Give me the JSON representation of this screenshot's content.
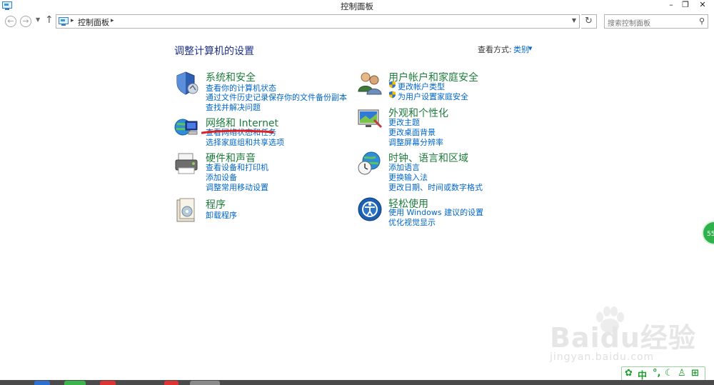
{
  "window": {
    "title": "控制面板",
    "minimize_glyph": "–",
    "restore_glyph": "❐",
    "close_glyph": "✕"
  },
  "address_bar": {
    "path": "控制面板",
    "search_placeholder": "搜索控制面板"
  },
  "main": {
    "heading": "调整计算机的设置",
    "view_by_label": "查看方式:",
    "view_by_value": "类别"
  },
  "categories_left": [
    {
      "title": "系统和安全",
      "icon": "shield-icon",
      "links": [
        "查看你的计算机状态",
        "通过文件历史记录保存你的文件备份副本",
        "查找并解决问题"
      ]
    },
    {
      "title": "网络和 Internet",
      "icon": "network-globe-icon",
      "links": [
        "查看网络状态和任务",
        "选择家庭组和共享选项"
      ]
    },
    {
      "title": "硬件和声音",
      "icon": "printer-icon",
      "links": [
        "查看设备和打印机",
        "添加设备",
        "调整常用移动设置"
      ]
    },
    {
      "title": "程序",
      "icon": "programs-icon",
      "links": [
        "卸载程序"
      ]
    }
  ],
  "categories_right": [
    {
      "title": "用户帐户和家庭安全",
      "icon": "users-icon",
      "links": [
        "更改帐户类型",
        "为用户设置家庭安全"
      ]
    },
    {
      "title": "外观和个性化",
      "icon": "monitor-paint-icon",
      "links": [
        "更改主题",
        "更改桌面背景",
        "调整屏幕分辨率"
      ]
    },
    {
      "title": "时钟、语言和区域",
      "icon": "clock-globe-icon",
      "links": [
        "添加语言",
        "更换输入法",
        "更改日期、时间或数字格式"
      ]
    },
    {
      "title": "轻松使用",
      "icon": "ease-of-access-icon",
      "links": [
        "使用 Windows 建议的设置",
        "优化视觉显示"
      ]
    }
  ],
  "overlay": {
    "side_badge": "55",
    "watermark_text": "Baidu经验",
    "watermark_url": "jingyan.baidu.com",
    "ime_mode": "中"
  },
  "colors": {
    "heading": "#1e3287",
    "category_title": "#1e7c3c",
    "link": "#0066cc",
    "annotation": "#e02020",
    "ime_green": "#1c9d2c"
  }
}
